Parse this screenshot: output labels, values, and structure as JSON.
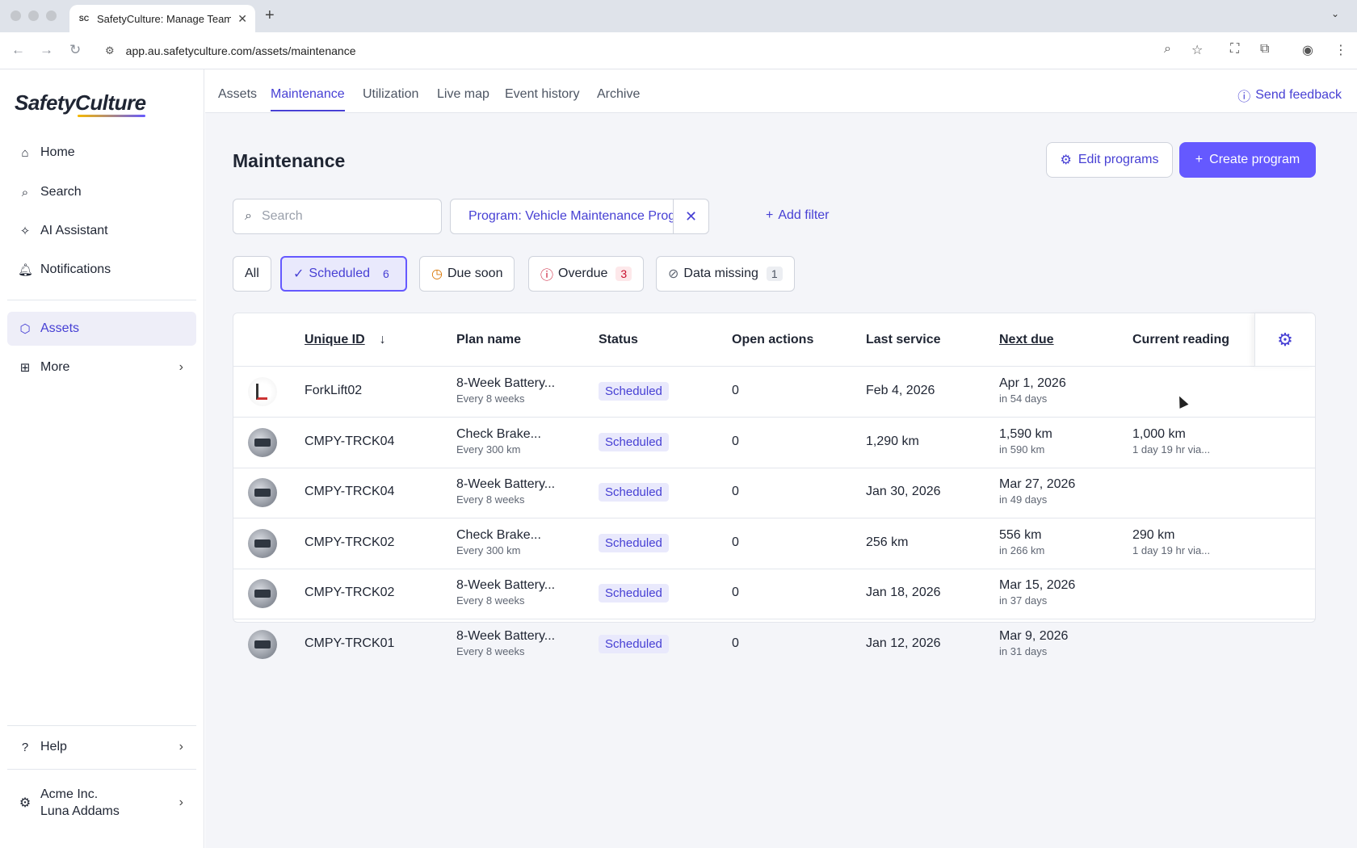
{
  "browser": {
    "tab_title": "SafetyCulture: Manage Teams",
    "favicon_text": "SC",
    "url": "app.au.safetyculture.com/assets/maintenance"
  },
  "sidebar": {
    "logo": "SafetyCulture",
    "items": [
      {
        "label": "Home",
        "icon": "home-icon"
      },
      {
        "label": "Search",
        "icon": "search-icon"
      },
      {
        "label": "AI Assistant",
        "icon": "sparkle-icon"
      },
      {
        "label": "Notifications",
        "icon": "bell-icon"
      },
      {
        "label": "Assets",
        "icon": "cube-icon",
        "active": true
      },
      {
        "label": "More",
        "icon": "grid-icon"
      }
    ],
    "help": "Help",
    "account": {
      "org": "Acme Inc.",
      "user": "Luna Addams"
    }
  },
  "topnav": {
    "tabs": [
      "Assets",
      "Maintenance",
      "Utilization",
      "Live map",
      "Event history",
      "Archive"
    ],
    "active_tab": "Maintenance",
    "feedback": "Send feedback"
  },
  "main": {
    "title": "Maintenance",
    "edit_programs": "Edit programs",
    "create_program": "Create program",
    "search_placeholder": "Search",
    "filter_label": "Program: Vehicle Maintenance Prog...",
    "add_filter": "Add filter",
    "status_pills": [
      {
        "label": "All",
        "count": ""
      },
      {
        "label": "Scheduled",
        "count": "6"
      },
      {
        "label": "Due soon",
        "count": ""
      },
      {
        "label": "Overdue",
        "count": "3"
      },
      {
        "label": "Data missing",
        "count": "1"
      }
    ]
  },
  "table": {
    "columns": [
      "Unique ID",
      "Plan name",
      "Status",
      "Open actions",
      "Last service",
      "Next due",
      "Current reading"
    ],
    "rows": [
      {
        "id": "ForkLift02",
        "plan": "8-Week Battery...",
        "plan_sub": "Every 8 weeks",
        "status": "Scheduled",
        "open_actions": "0",
        "last_service": "Feb 4, 2026",
        "next_due": "Apr 1, 2026",
        "next_due_sub": "in 54 days",
        "reading": "",
        "reading_sub": "",
        "thumb": "forklift"
      },
      {
        "id": "CMPY-TRCK04",
        "plan": "Check Brake...",
        "plan_sub": "Every 300 km",
        "status": "Scheduled",
        "open_actions": "0",
        "last_service": "1,290 km",
        "next_due": "1,590 km",
        "next_due_sub": "in 590 km",
        "reading": "1,000 km",
        "reading_sub": "1 day 19 hr via...",
        "thumb": "truck"
      },
      {
        "id": "CMPY-TRCK04",
        "plan": "8-Week Battery...",
        "plan_sub": "Every 8 weeks",
        "status": "Scheduled",
        "open_actions": "0",
        "last_service": "Jan 30, 2026",
        "next_due": "Mar 27, 2026",
        "next_due_sub": "in 49 days",
        "reading": "",
        "reading_sub": "",
        "thumb": "truck"
      },
      {
        "id": "CMPY-TRCK02",
        "plan": "Check Brake...",
        "plan_sub": "Every 300 km",
        "status": "Scheduled",
        "open_actions": "0",
        "last_service": "256 km",
        "next_due": "556 km",
        "next_due_sub": "in 266 km",
        "reading": "290 km",
        "reading_sub": "1 day 19 hr via...",
        "thumb": "truck"
      },
      {
        "id": "CMPY-TRCK02",
        "plan": "8-Week Battery...",
        "plan_sub": "Every 8 weeks",
        "status": "Scheduled",
        "open_actions": "0",
        "last_service": "Jan 18, 2026",
        "next_due": "Mar 15, 2026",
        "next_due_sub": "in 37 days",
        "reading": "",
        "reading_sub": "",
        "thumb": "truck"
      },
      {
        "id": "CMPY-TRCK01",
        "plan": "8-Week Battery...",
        "plan_sub": "Every 8 weeks",
        "status": "Scheduled",
        "open_actions": "0",
        "last_service": "Jan 12, 2026",
        "next_due": "Mar 9, 2026",
        "next_due_sub": "in 31 days",
        "reading": "",
        "reading_sub": "",
        "thumb": "truck"
      }
    ]
  },
  "colors": {
    "accent": "#6559ff",
    "accent_text": "#4740d4",
    "page_bg": "#f4f5f9",
    "overdue": "#c8102e"
  }
}
